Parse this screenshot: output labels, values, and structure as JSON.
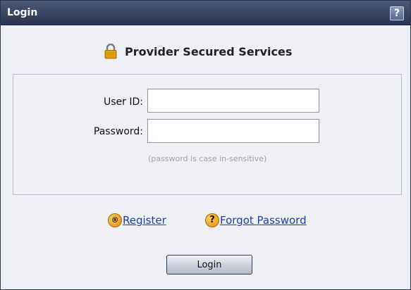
{
  "window": {
    "title": "Login",
    "help_label": "?"
  },
  "heading": {
    "icon": "lock-icon",
    "text": "Provider Secured Services"
  },
  "form": {
    "user_id_label": "User ID:",
    "user_id_value": "",
    "password_label": "Password:",
    "password_value": "",
    "password_hint": "(password is case in-sensitive)"
  },
  "links": {
    "register_icon": "registered-icon",
    "register_icon_glyph": "®",
    "register_label": "Register",
    "forgot_icon": "question-icon",
    "forgot_icon_glyph": "?",
    "forgot_label": "Forgot Password"
  },
  "actions": {
    "login_label": "Login"
  },
  "colors": {
    "titlebar": "#2a3550",
    "panel_bg": "#eef0f6",
    "link": "#1f3fae",
    "badge": "#e08a00"
  }
}
